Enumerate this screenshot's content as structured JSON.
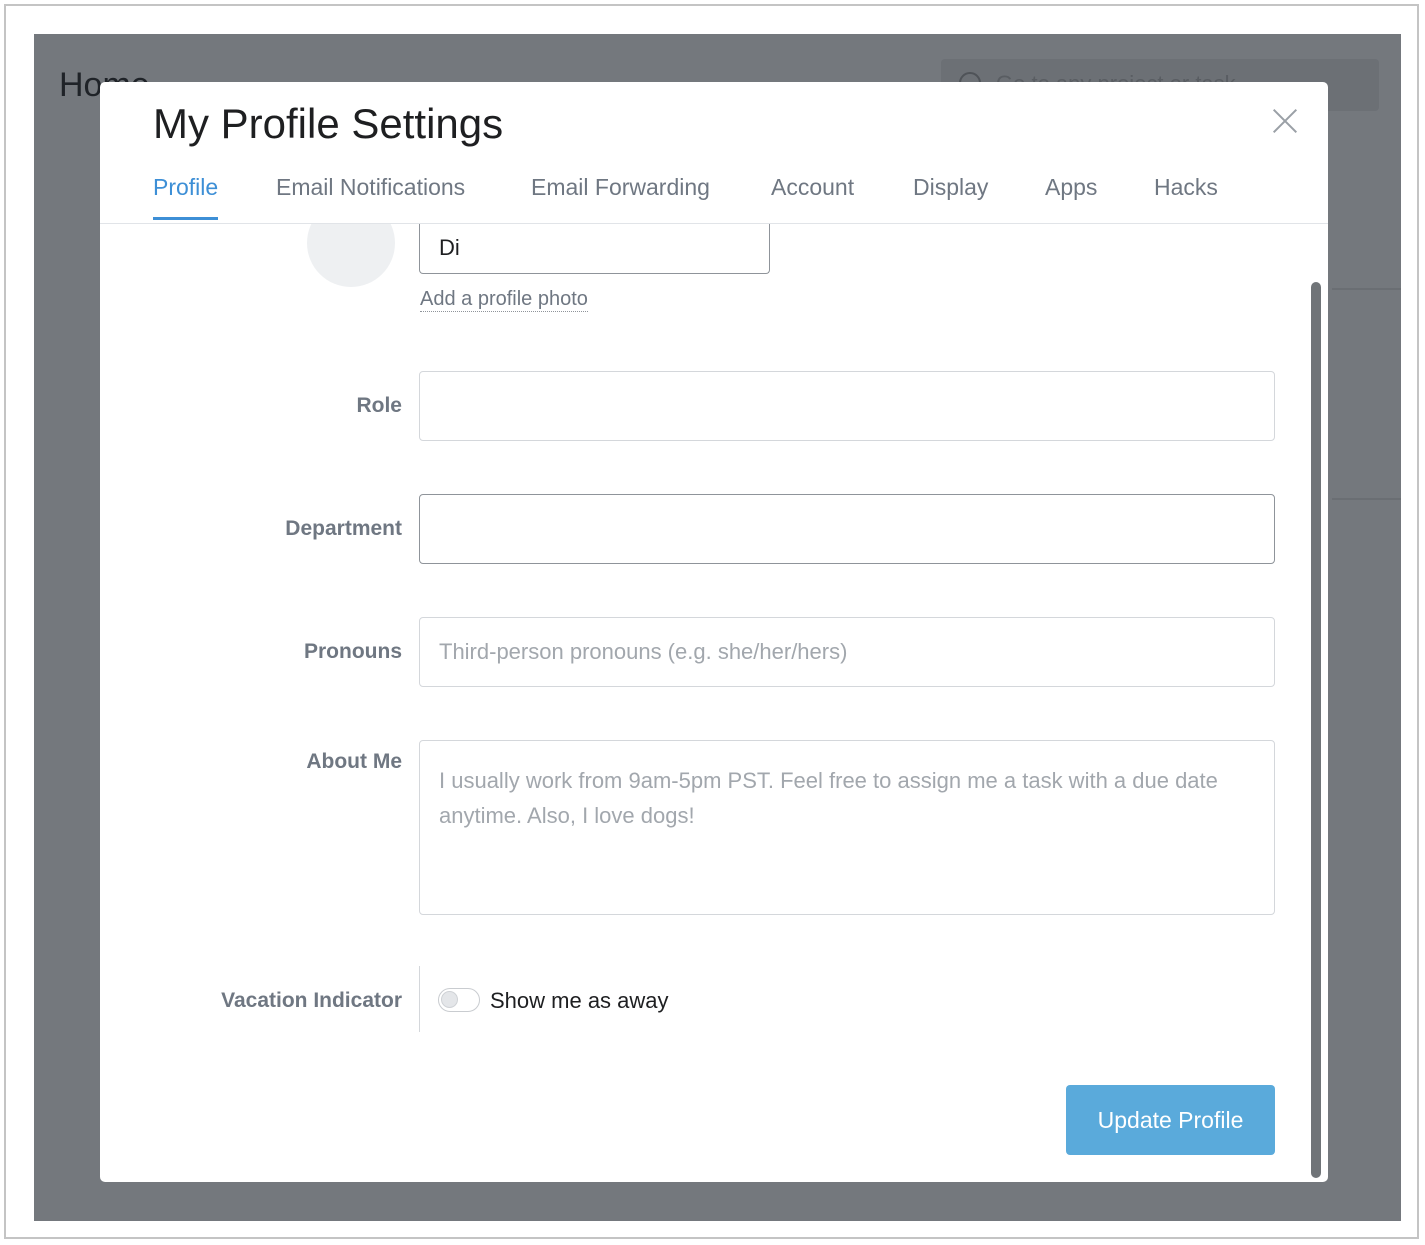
{
  "background": {
    "page_title": "Home",
    "search_placeholder": "Go to any project or task"
  },
  "modal": {
    "title": "My Profile Settings",
    "close_icon": "close-icon",
    "tabs": [
      {
        "label": "Profile",
        "active": true
      },
      {
        "label": "Email Notifications",
        "active": false
      },
      {
        "label": "Email Forwarding",
        "active": false
      },
      {
        "label": "Account",
        "active": false
      },
      {
        "label": "Display",
        "active": false
      },
      {
        "label": "Apps",
        "active": false
      },
      {
        "label": "Hacks",
        "active": false
      }
    ]
  },
  "profile": {
    "name_value": "Di",
    "add_photo_label": "Add a profile photo",
    "role": {
      "label": "Role",
      "value": ""
    },
    "department": {
      "label": "Department",
      "value": ""
    },
    "pronouns": {
      "label": "Pronouns",
      "placeholder": "Third-person pronouns (e.g. she/her/hers)"
    },
    "about": {
      "label": "About Me",
      "placeholder": "I usually work from 9am-5pm PST. Feel free to assign me a task with a due date anytime. Also, I love dogs!"
    },
    "vacation": {
      "label": "Vacation Indicator",
      "toggle_label": "Show me as away",
      "enabled": false
    },
    "update_button": "Update Profile"
  },
  "colors": {
    "accent": "#3d8fd6",
    "button": "#5aaadb",
    "overlay": "#74787d"
  }
}
